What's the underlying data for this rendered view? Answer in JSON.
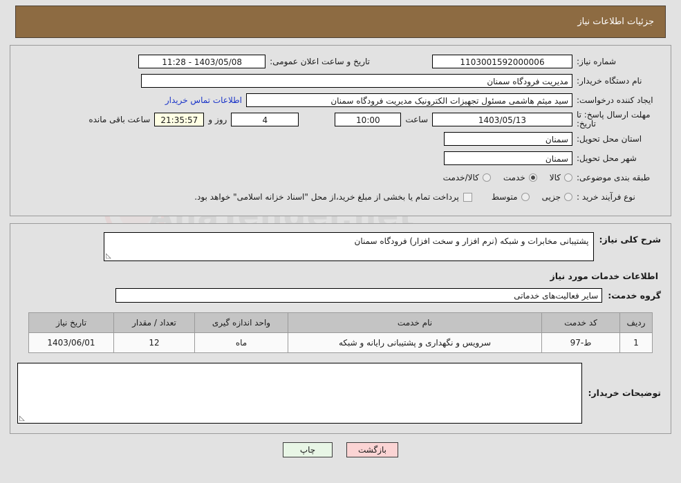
{
  "header": {
    "title": "جزئیات اطلاعات نیاز"
  },
  "form": {
    "need_number_label": "شماره نیاز:",
    "need_number_value": "1103001592000006",
    "announce_datetime_label": "تاریخ و ساعت اعلان عمومی:",
    "announce_datetime_value": "1403/05/08 - 11:28",
    "buyer_org_label": "نام دستگاه خریدار:",
    "buyer_org_value": "مدیریت فرودگاه سمنان",
    "creator_label": "ایجاد کننده درخواست:",
    "creator_value": "سید میثم هاشمی مسئول تجهیزات الکترونیک مدیریت فرودگاه سمنان",
    "contact_link": "اطلاعات تماس خریدار",
    "deadline_label": "مهلت ارسال پاسخ: تا تاریخ:",
    "deadline_date": "1403/05/13",
    "deadline_hour_label": "ساعت",
    "deadline_hour": "10:00",
    "remaining_days": "4",
    "remaining_days_label": "روز و",
    "remaining_time": "21:35:57",
    "remaining_time_label": "ساعت باقی مانده",
    "province_label": "استان محل تحویل:",
    "province_value": "سمنان",
    "city_label": "شهر محل تحویل:",
    "city_value": "سمنان",
    "category_label": "طبقه بندی موضوعی:",
    "category_options": [
      {
        "label": "کالا",
        "selected": false
      },
      {
        "label": "خدمت",
        "selected": true
      },
      {
        "label": "کالا/خدمت",
        "selected": false
      }
    ],
    "process_label": "نوع فرآیند خرید :",
    "process_options": [
      {
        "label": "جزیی",
        "selected": false
      },
      {
        "label": "متوسط",
        "selected": false
      }
    ],
    "treasury_checkbox_label": "پرداخت تمام یا بخشی از مبلغ خرید،از محل \"اسناد خزانه اسلامی\" خواهد بود.",
    "treasury_checked": false
  },
  "description": {
    "label": "شرح کلی نیاز:",
    "value": "پشتیبانی مخابرات و شبکه (نرم افزار و سخت افزار) فرودگاه سمنان"
  },
  "services": {
    "section_title": "اطلاعات خدمات مورد نیاز",
    "group_label": "گروه خدمت:",
    "group_value": "سایر فعالیت‌های خدماتی",
    "table": {
      "columns": [
        "ردیف",
        "کد خدمت",
        "نام خدمت",
        "واحد اندازه گیری",
        "تعداد / مقدار",
        "تاریخ نیاز"
      ],
      "rows": [
        [
          "1",
          "ط-97",
          "سرویس و نگهداری و پشتیبانی رایانه و شبکه",
          "ماه",
          "12",
          "1403/06/01"
        ]
      ]
    }
  },
  "buyer_notes": {
    "label": "توضیحات خریدار:",
    "value": ""
  },
  "footer": {
    "print_label": "چاپ",
    "back_label": "بازگشت"
  },
  "watermark": {
    "text": "AnaTender.net"
  },
  "colors": {
    "header_bg": "#8d6b42",
    "page_bg": "#e2e2e2",
    "link": "#1a34c8",
    "table_header_bg": "#c4c4c4",
    "print_btn_bg": "#e8f6e6",
    "back_btn_bg": "#fbd4d4",
    "countdown_bg": "#ffffe4"
  }
}
